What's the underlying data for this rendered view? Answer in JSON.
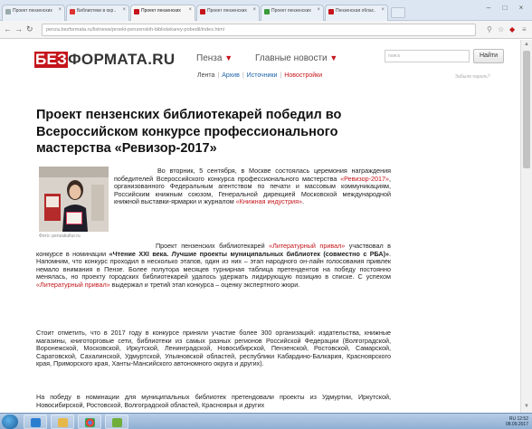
{
  "browser": {
    "tabs": [
      {
        "title": "Проект пензенских…"
      },
      {
        "title": "Библиотеки в окр…"
      },
      {
        "title": "Проект пензенских…"
      },
      {
        "title": "Проект пензенских…"
      },
      {
        "title": "Проект пензенских…"
      },
      {
        "title": "Пензенская облас…"
      }
    ],
    "url": "penza.bezformata.ru/listnews/proekt-penzenskih-bibliotekarey-pobedil/index.html"
  },
  "site": {
    "logo_be": "БЕЗ",
    "logo_rest": "ФОРМАТА.RU",
    "city": "Пенза",
    "main_news": "Главные новости",
    "search_placeholder": "поиск",
    "find_button": "Найти",
    "subnav": {
      "feed": "Лента",
      "archive": "Архив",
      "sources": "Источники",
      "new": "Новостройки"
    },
    "forgot": "Забыли пароль?"
  },
  "article": {
    "title": "Проект пензенских библиотекарей победил во Всероссийском конкурсе профессионального мастерства «Ревизор-2017»",
    "photo_caption": "Фото: penzakultur.ru",
    "lead": {
      "t1": "Во вторник, 5 сентября, в Москве состоялась церемония награждения победителей Всероссийского конкурса профессионального мастерства ",
      "link1": "«Ревизор-2017»",
      "t2": ", организованного Федеральным агентством по печати и массовым коммуникациям, Российским книжным союзом, Генеральной дирекцией Московской международной книжной выставки-ярмарки и журналом ",
      "link2": "«Книжная индустрия»",
      "t3": "."
    },
    "p2": {
      "t1": "Проект пензенских библиотекарей ",
      "link1": "«Литературный привал»",
      "t2": " участвовал в конкурсе в номинации ",
      "bold1": "«Чтение XXI века. Лучшие проекты муниципальных библиотек (совместно с РБА)»",
      "t3": ". Напомним, что конкурс проходил в несколько этапов, один из них – этап народного он-лайн голосования привлек немало внимания в Пензе. Более полутора месяцев турнирная таблица претендентов на победу постоянно менялась, но проекту городских библиотекарей удалось удержать лидирующую позицию в списке. С успехом ",
      "link2": "«Литературный привал»",
      "t4": " выдержал и третий этап конкурса – оценку экспертного жюри."
    },
    "p3": "Стоит отметить, что в 2017 году в конкурсе приняли участие более 300 организаций: издательства, книжные магазины, книготорговые сети, библиотеки из самых разных регионов Российской Федерации (Волгоградской, Воронежской, Московской, Иркутской, Ленинградской, Новосибирской, Пензенской, Ростовской, Самарской, Саратовской, Сахалинской, Удмуртской, Ульяновской областей, республики Кабардино-Балкария, Красноярского края, Приморского края, Ханты-Мансийского автономного округа и других).",
    "p4": "На победу в номинации для муниципальных библиотек претендовали проекты из Удмуртии, Иркутской, Новосибирской, Ростовской, Волгоградской областей, Красноярья и других"
  },
  "taskbar": {
    "time": "12:52",
    "date": "08.09.2017",
    "lang": "RU"
  },
  "colors": {
    "brand_red": "#c4161c",
    "link_blue": "#1b62a8",
    "taskbar": "#9fbad9"
  }
}
